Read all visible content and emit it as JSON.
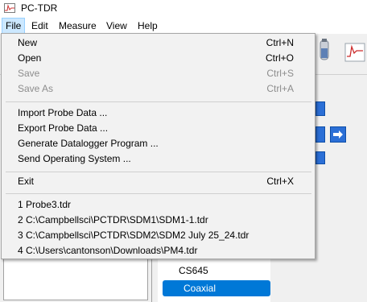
{
  "window": {
    "title": "PC-TDR"
  },
  "menubar": {
    "items": [
      "File",
      "Edit",
      "Measure",
      "View",
      "Help"
    ],
    "active": "File"
  },
  "file_menu": {
    "group1": [
      {
        "label": "New",
        "shortcut": "Ctrl+N",
        "enabled": true
      },
      {
        "label": "Open",
        "shortcut": "Ctrl+O",
        "enabled": true
      },
      {
        "label": "Save",
        "shortcut": "Ctrl+S",
        "enabled": false
      },
      {
        "label": "Save As",
        "shortcut": "Ctrl+A",
        "enabled": false
      }
    ],
    "group2": [
      {
        "label": "Import Probe Data ..."
      },
      {
        "label": "Export Probe Data ..."
      },
      {
        "label": "Generate Datalogger Program ..."
      },
      {
        "label": "Send Operating System ..."
      }
    ],
    "group3": [
      {
        "label": "Exit",
        "shortcut": "Ctrl+X"
      }
    ],
    "recent_files": [
      "1 Probe3.tdr",
      "2 C:\\Campbellsci\\PCTDR\\SDM1\\SDM1-1.tdr",
      "3 C:\\Campbellsci\\PCTDR\\SDM2\\SDM2 July 25_24.tdr",
      "4 C:\\Users\\cantonson\\Downloads\\PM4.tdr"
    ]
  },
  "probe_list": {
    "items": [
      "CS645",
      "Coaxial"
    ],
    "selected": "Coaxial"
  },
  "colors": {
    "menu_highlight": "#cce8ff",
    "selection": "#0078d7",
    "arrow_button": "#2b6fd6"
  }
}
